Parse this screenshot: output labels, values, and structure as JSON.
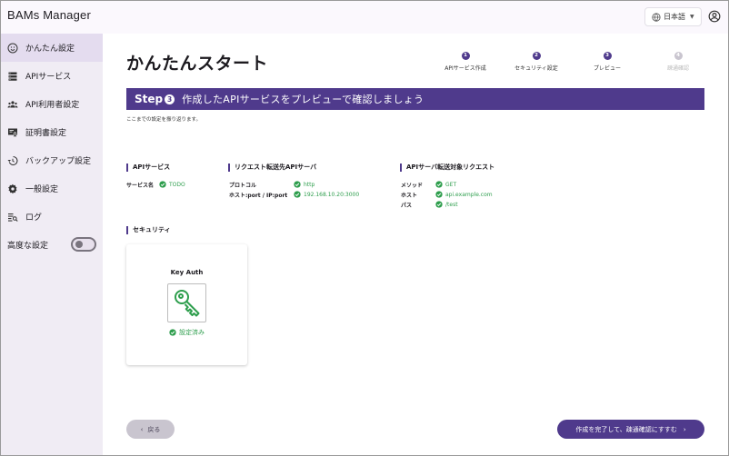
{
  "app": {
    "title": "BAMs Manager"
  },
  "header": {
    "language": "日本語",
    "language_icon": "globe-icon",
    "account_icon": "account-circle-icon"
  },
  "sidebar": {
    "items": [
      {
        "label": "かんたん設定",
        "icon": "smiley-icon",
        "active": true
      },
      {
        "label": "APIサービス",
        "icon": "server-icon"
      },
      {
        "label": "API利用者設定",
        "icon": "group-icon"
      },
      {
        "label": "証明書設定",
        "icon": "certificate-icon"
      },
      {
        "label": "バックアップ設定",
        "icon": "backup-icon"
      },
      {
        "label": "一般設定",
        "icon": "gear-icon"
      },
      {
        "label": "ログ",
        "icon": "log-icon"
      }
    ],
    "advanced": {
      "label": "高度な設定",
      "enabled": false
    }
  },
  "page": {
    "title": "かんたんスタート"
  },
  "stepper": {
    "steps": [
      {
        "number": "1",
        "label": "APIサービス作成",
        "state": "done"
      },
      {
        "number": "2",
        "label": "セキュリティ設定",
        "state": "done"
      },
      {
        "number": "3",
        "label": "プレビュー",
        "state": "current"
      },
      {
        "number": "4",
        "label": "疎通確認",
        "state": "pending"
      }
    ]
  },
  "banner": {
    "step_word": "Step",
    "step_number": "3",
    "text": "作成したAPIサービスをプレビューで確認しましょう"
  },
  "subtitle": "ここまでの設定を振り返ります。",
  "api_service": {
    "heading": "APIサービス",
    "name_label": "サービス名",
    "name_value": "TODO"
  },
  "forward": {
    "heading": "リクエスト転送先APIサーバ",
    "protocol_label": "プロトコル",
    "protocol_value": "http",
    "host_label": "ホスト:port / IP:port",
    "host_value": "192.168.10.20:3000"
  },
  "target": {
    "heading": "APIサーバ転送対象リクエスト",
    "method_label": "メソッド",
    "method_value": "GET",
    "host_label": "ホスト",
    "host_value": "api.example.com",
    "path_label": "パス",
    "path_value": "/test"
  },
  "security": {
    "heading": "セキュリティ",
    "card_title": "Key Auth",
    "card_icon": "key-icon",
    "status": "設定済み"
  },
  "buttons": {
    "back": "戻る",
    "next": "作成を完了して、疎通確認にすすむ"
  },
  "colors": {
    "primary": "#4f3a8c",
    "success": "#2e9e4d",
    "sidebar_bg": "#f0ecf4"
  }
}
